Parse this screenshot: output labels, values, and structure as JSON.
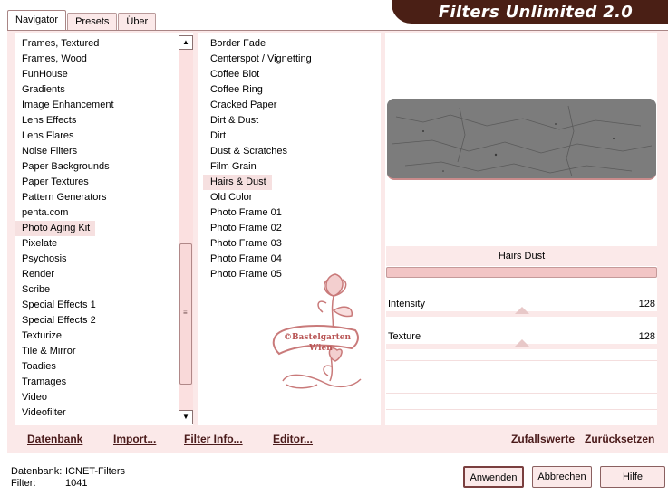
{
  "tabs": [
    "Navigator",
    "Presets",
    "Über"
  ],
  "title": "Filters Unlimited 2.0",
  "categories": {
    "items": [
      "Frames, Textured",
      "Frames, Wood",
      "FunHouse",
      "Gradients",
      "Image Enhancement",
      "Lens Effects",
      "Lens Flares",
      "Noise Filters",
      "Paper Backgrounds",
      "Paper Textures",
      "Pattern Generators",
      "penta.com",
      "Photo Aging Kit",
      "Pixelate",
      "Psychosis",
      "Render",
      "Scribe",
      "Special Effects 1",
      "Special Effects 2",
      "Texturize",
      "Tile & Mirror",
      "Toadies",
      "Tramages",
      "Video",
      "Videofilter"
    ],
    "selected": "Photo Aging Kit"
  },
  "filters": {
    "items": [
      "Border Fade",
      "Centerspot / Vignetting",
      "Coffee Blot",
      "Coffee Ring",
      "Cracked Paper",
      "Dirt & Dust",
      "Dirt",
      "Dust & Scratches",
      "Film Grain",
      "Hairs & Dust",
      "Old Color",
      "Photo Frame 01",
      "Photo Frame 02",
      "Photo Frame 03",
      "Photo Frame 04",
      "Photo Frame 05"
    ],
    "selected": "Hairs & Dust"
  },
  "filter_name": "Hairs  Dust",
  "params": [
    {
      "label": "Intensity",
      "value": "128",
      "level": 0.5
    },
    {
      "label": "Texture",
      "value": "128",
      "level": 0.5
    }
  ],
  "bottom_left": {
    "datenbank": "Datenbank",
    "import": "Import...",
    "filterinfo": "Filter Info...",
    "editor": "Editor..."
  },
  "bottom_right": {
    "random": "Zufallswerte",
    "reset": "Zurücksetzen"
  },
  "status": {
    "db_label": "Datenbank:",
    "db_value": "ICNET-Filters",
    "filter_label": "Filter:",
    "filter_value": "1041"
  },
  "buttons": {
    "apply": "Anwenden",
    "cancel": "Abbrechen",
    "help": "Hilfe"
  },
  "watermark": {
    "line1": "©Bastelgarten",
    "line2": "Wien"
  },
  "colors": {
    "accent": "#4a1f15",
    "panel": "#fbe9e9"
  }
}
